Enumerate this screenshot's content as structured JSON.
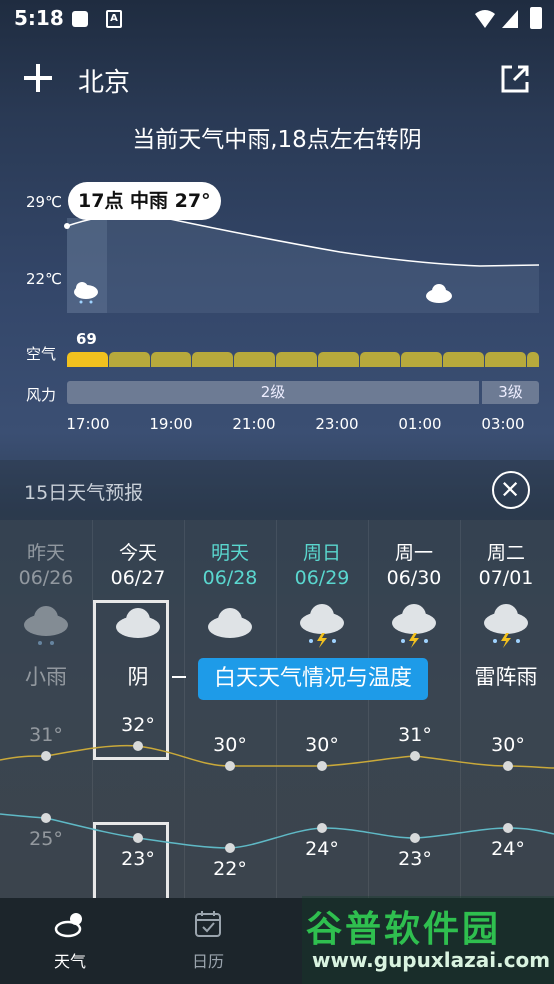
{
  "status_bar": {
    "time": "5:18",
    "badge": "A"
  },
  "header": {
    "city": "北京"
  },
  "summary": "当前天气中雨,18点左右转阴",
  "hourly": {
    "temp_max_label": "29℃",
    "temp_min_label": "22℃",
    "bubble": "17点 中雨 27°",
    "air_label": "空气",
    "air_value": "69",
    "wind_label": "风力",
    "wind_levels": [
      "2级",
      "3级"
    ],
    "hours": [
      "17:00",
      "19:00",
      "21:00",
      "23:00",
      "01:00",
      "03:00"
    ]
  },
  "forecast": {
    "title": "15日天气预报",
    "tooltip": "白天天气情况与温度",
    "days": [
      {
        "name": "昨天",
        "date": "06/26",
        "cond": "小雨",
        "high": "31°",
        "low": "25°",
        "icon": "rain-cloud-icon"
      },
      {
        "name": "今天",
        "date": "06/27",
        "cond": "阴",
        "high": "32°",
        "low": "23°",
        "icon": "cloud-icon"
      },
      {
        "name": "明天",
        "date": "06/28",
        "cond": "",
        "high": "30°",
        "low": "22°",
        "icon": "cloud-icon"
      },
      {
        "name": "周日",
        "date": "06/29",
        "cond": "",
        "high": "30°",
        "low": "24°",
        "icon": "thunderstorm-icon"
      },
      {
        "name": "周一",
        "date": "06/30",
        "cond": "",
        "high": "31°",
        "low": "23°",
        "icon": "thunderstorm-icon"
      },
      {
        "name": "周二",
        "date": "07/01",
        "cond": "雷阵雨",
        "high": "30°",
        "low": "24°",
        "icon": "thunderstorm-icon"
      }
    ]
  },
  "nav": {
    "weather": "天气",
    "calendar": "日历"
  },
  "watermark": {
    "title": "谷普软件园",
    "url": "www.gupuxlazai.com"
  },
  "colors": {
    "air_first": "#f2c11e",
    "air_bar": "#b7a93c",
    "high_line": "#c9a93a",
    "low_line": "#5fb9c6",
    "tooltip": "#1e9be8",
    "weekend": "#5ad7cf"
  }
}
